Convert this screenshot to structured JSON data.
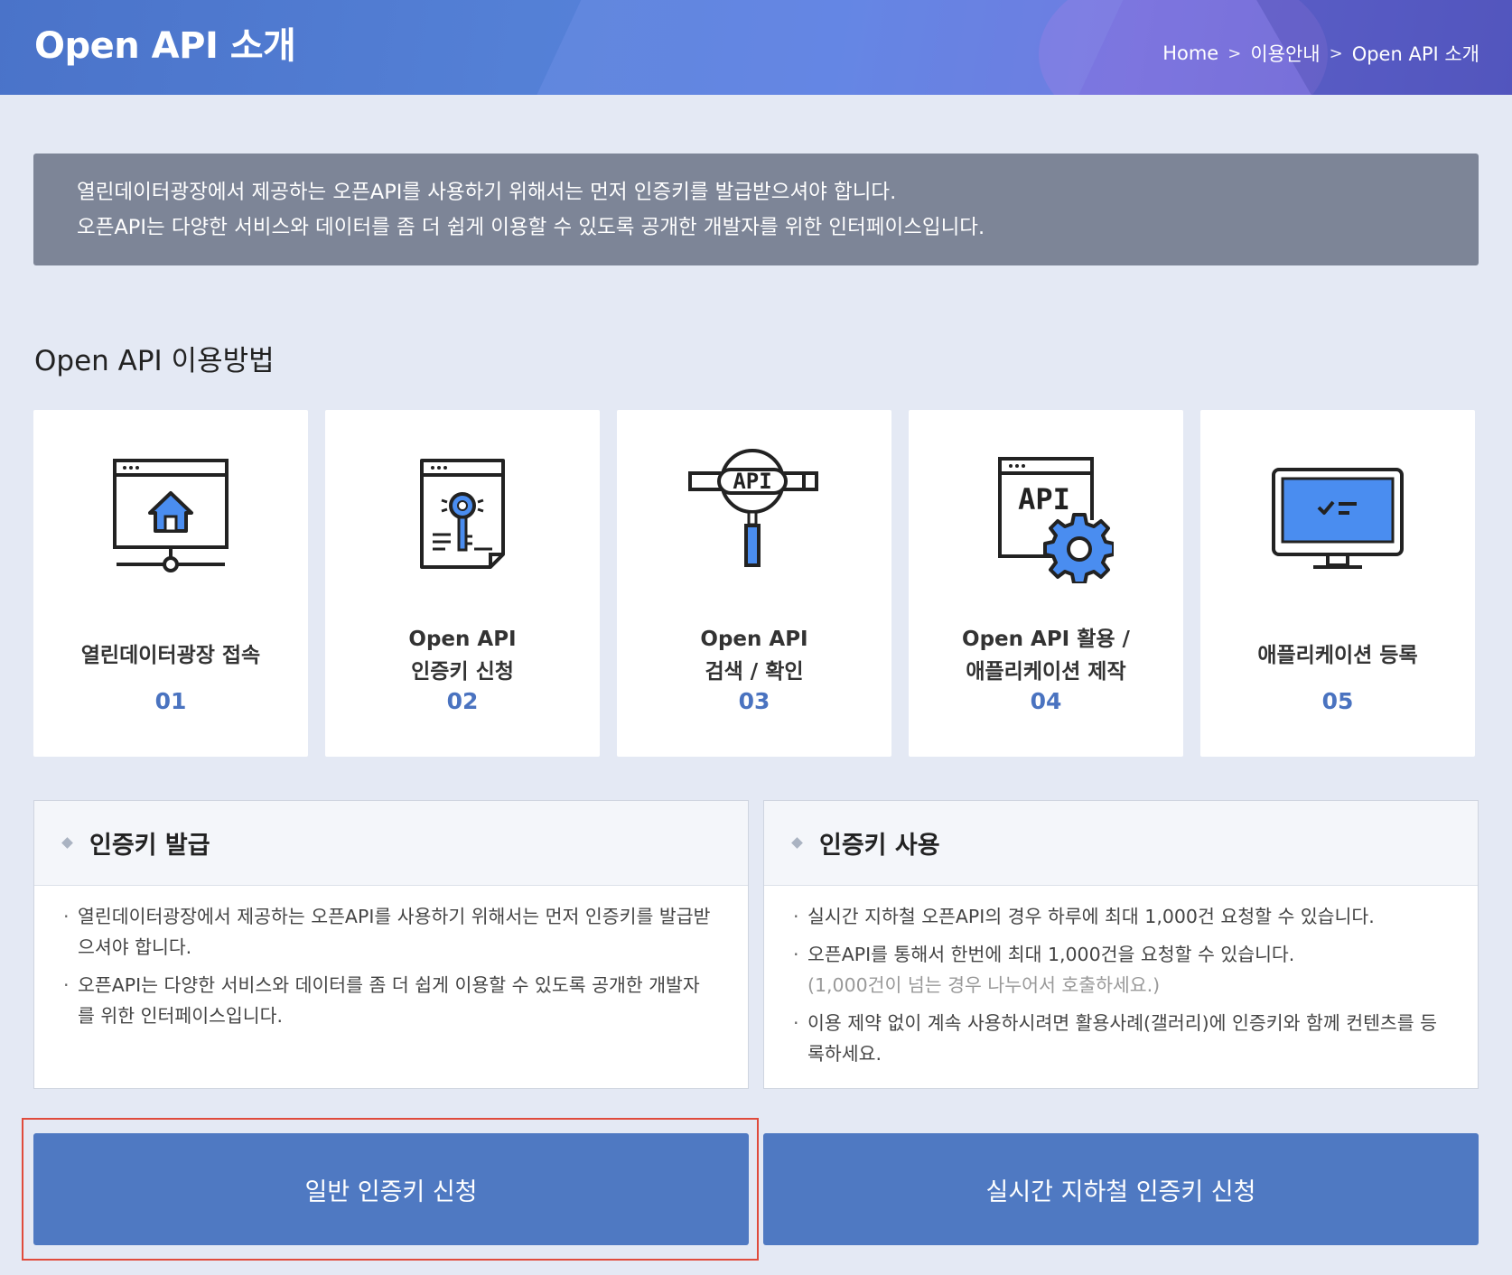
{
  "header": {
    "title": "Open API 소개",
    "breadcrumb": [
      "Home",
      "이용안내",
      "Open API 소개"
    ]
  },
  "notice": {
    "line1": "열린데이터광장에서 제공하는 오픈API를 사용하기 위해서는 먼저 인증키를 발급받으셔야 합니다.",
    "line2": "오픈API는 다양한 서비스와 데이터를 좀 더 쉽게 이용할 수 있도록 공개한 개발자를 위한 인터페이스입니다."
  },
  "usage": {
    "title": "Open API 이용방법",
    "steps": [
      {
        "line1": "열린데이터광장 접속",
        "line2": "",
        "num": "01",
        "icon": "website-home-icon"
      },
      {
        "line1": "Open API",
        "line2": "인증키 신청",
        "num": "02",
        "icon": "document-key-icon"
      },
      {
        "line1": "Open API",
        "line2": "검색 / 확인",
        "num": "03",
        "icon": "api-magnifier-icon"
      },
      {
        "line1": "Open API 활용 /",
        "line2": "애플리케이션 제작",
        "num": "04",
        "icon": "api-window-gear-icon"
      },
      {
        "line1": "애플리케이션 등록",
        "line2": "",
        "num": "05",
        "icon": "monitor-checklist-icon"
      }
    ]
  },
  "issue": {
    "title": "인증키 발급",
    "items": [
      "열린데이터광장에서 제공하는 오픈API를 사용하기 위해서는 먼저 인증키를 발급받으셔야 합니다.",
      "오픈API는 다양한 서비스와 데이터를 좀 더 쉽게 이용할 수 있도록 공개한 개발자를 위한 인터페이스입니다."
    ]
  },
  "use": {
    "title": "인증키 사용",
    "items": [
      "실시간 지하철 오픈API의 경우 하루에 최대 1,000건 요청할 수 있습니다.",
      "오픈API를 통해서 한번에 최대 1,000건을 요청할 수 있습니다.",
      "이용 제약 없이 계속 사용하시려면 활용사례(갤러리)에 인증키와 함께 컨텐츠를 등록하세요."
    ],
    "note": "(1,000건이 넘는 경우 나누어서 호출하세요.)"
  },
  "buttons": {
    "general": "일반 인증키 신청",
    "subway": "실시간 지하철 인증키 신청"
  },
  "colors": {
    "accent": "#4f79c2",
    "number": "#4a73c0",
    "notice_bg": "#7d8597",
    "highlight": "#e04b3c"
  }
}
